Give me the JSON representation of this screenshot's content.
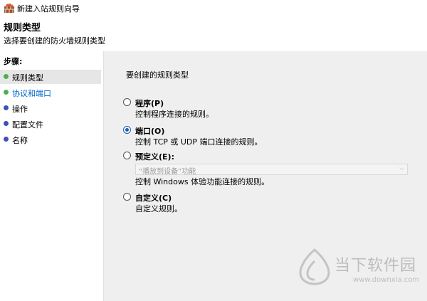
{
  "window": {
    "title": "新建入站规则向导"
  },
  "header": {
    "title": "规则类型",
    "subtitle": "选择要创建的防火墙规则类型"
  },
  "sidebar": {
    "steps_title": "步骤:",
    "steps": [
      {
        "label": "规则类型",
        "dot_color": "#4caf50"
      },
      {
        "label": "协议和端口",
        "dot_color": "#4caf50"
      },
      {
        "label": "操作",
        "dot_color": "#3f51b5"
      },
      {
        "label": "配置文件",
        "dot_color": "#3f51b5"
      },
      {
        "label": "名称",
        "dot_color": "#3f51b5"
      }
    ]
  },
  "main": {
    "prompt": "要创建的规则类型",
    "options": [
      {
        "label": "程序(P)",
        "desc": "控制程序连接的规则。",
        "selected": false
      },
      {
        "label": "端口(O)",
        "desc": "控制 TCP 或 UDP 端口连接的规则。",
        "selected": true
      },
      {
        "label": "预定义(E):",
        "desc": "控制 Windows 体验功能连接的规则。",
        "selected": false
      },
      {
        "label": "自定义(C)",
        "desc": "自定义规则。",
        "selected": false
      }
    ],
    "predefined_dropdown": {
      "value": "“播放到设备”功能"
    }
  },
  "watermark": {
    "text": "当下软件园",
    "url": "www.downxia.com"
  }
}
